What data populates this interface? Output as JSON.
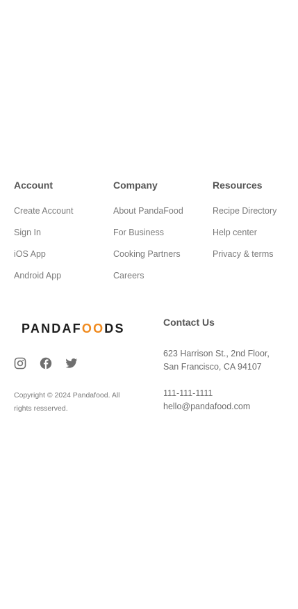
{
  "columns": {
    "account": {
      "title": "Account",
      "links": [
        "Create Account",
        "Sign In",
        "iOS App",
        "Android App"
      ]
    },
    "company": {
      "title": "Company",
      "links": [
        "About PandaFood",
        "For Business",
        "Cooking Partners",
        "Careers"
      ]
    },
    "resources": {
      "title": "Resources",
      "links": [
        "Recipe Directory",
        "Help center",
        "Privacy & terms"
      ]
    }
  },
  "brand": {
    "logo_prefix": "PANDAF",
    "logo_accent": "OO",
    "logo_suffix": "DS",
    "accent_color": "#f08a1e",
    "social_icons": [
      "instagram-icon",
      "facebook-icon",
      "twitter-icon"
    ],
    "copyright": "Copyright © 2024 Pandafood. All rights resserved."
  },
  "contact": {
    "title": "Contact Us",
    "address_line1": "623 Harrison St., 2nd Floor,",
    "address_line2": "San Francisco, CA 94107",
    "phone": "111-111-1111",
    "email": "hello@pandafood.com"
  }
}
